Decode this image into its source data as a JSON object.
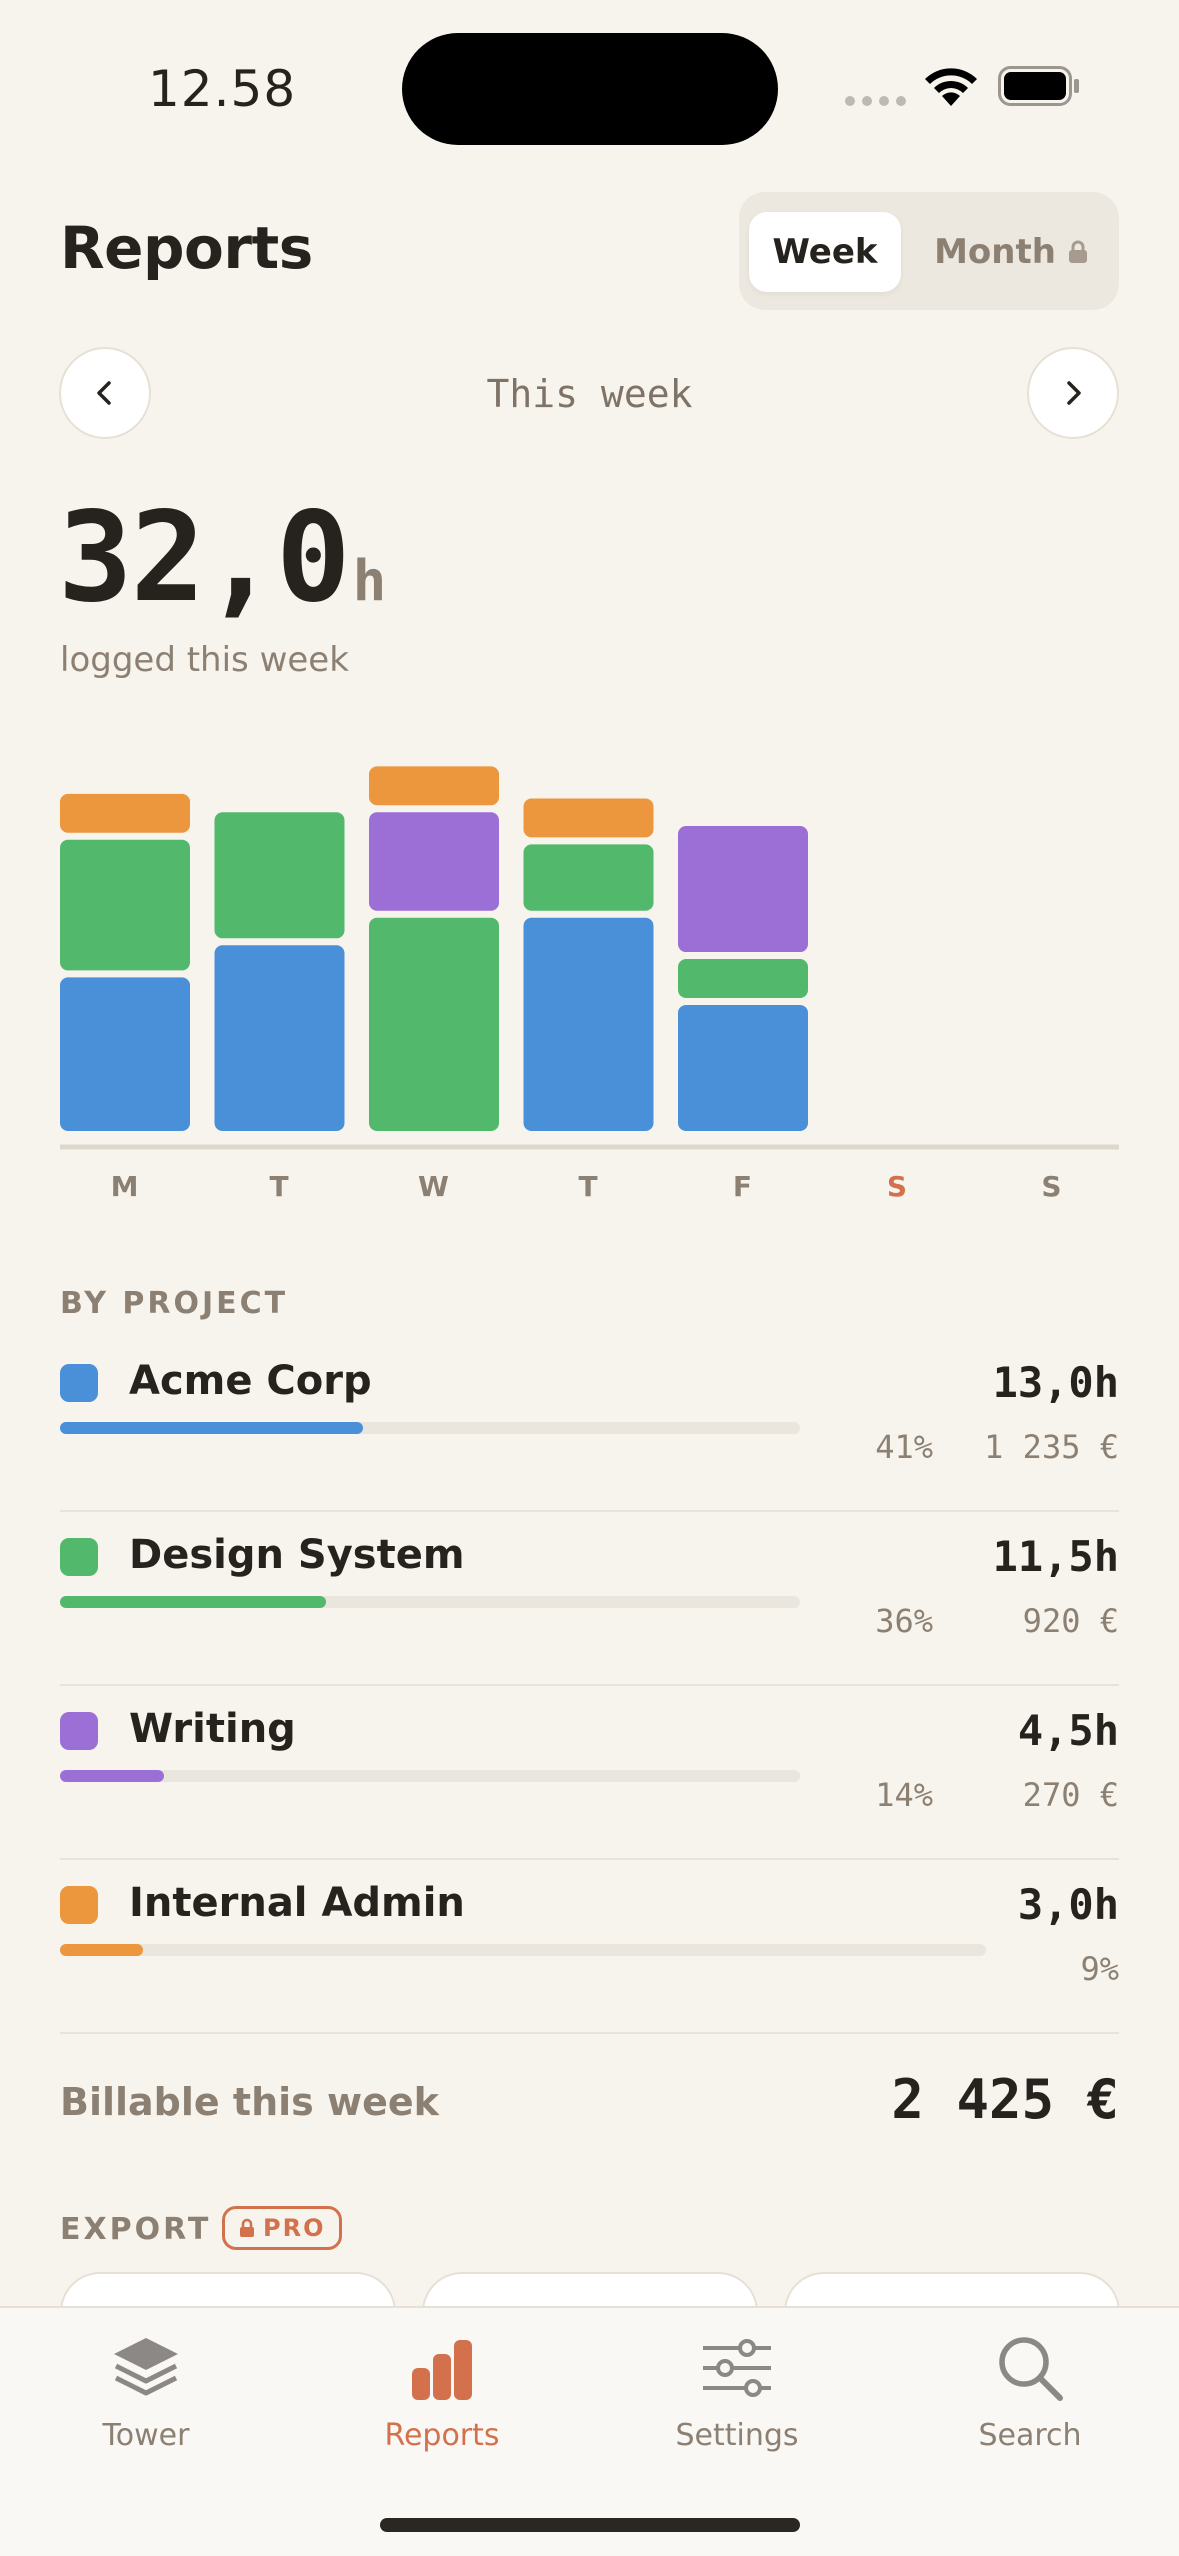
{
  "status": {
    "time": "12.58"
  },
  "header": {
    "title": "Reports",
    "segments": {
      "week": "Week",
      "month": "Month"
    }
  },
  "week_nav": {
    "label": "This week"
  },
  "total": {
    "value": "32,0",
    "unit": "h",
    "caption": "logged this week"
  },
  "colors": {
    "acme": "#4A90D9",
    "design": "#52B96C",
    "writing": "#9B6FD6",
    "admin": "#EC963D",
    "accent": "#D4714D"
  },
  "chart_data": {
    "type": "bar",
    "stacked": true,
    "categories": [
      "M",
      "T",
      "W",
      "T",
      "F",
      "S",
      "S"
    ],
    "weekend_highlight_index": 5,
    "series": [
      {
        "name": "Acme Corp",
        "color": "#4A90D9",
        "values": [
          3.5,
          4.2,
          0,
          4.8,
          2.9,
          0,
          0
        ]
      },
      {
        "name": "Design System",
        "color": "#52B96C",
        "values": [
          3.0,
          2.9,
          4.8,
          1.6,
          1.0,
          0,
          0
        ]
      },
      {
        "name": "Writing",
        "color": "#9B6FD6",
        "values": [
          0,
          0,
          2.3,
          0,
          2.9,
          0,
          0
        ]
      },
      {
        "name": "Internal Admin",
        "color": "#EC963D",
        "values": [
          1.0,
          0,
          1.0,
          1.0,
          0,
          0,
          0
        ]
      }
    ],
    "ylim": [
      0,
      8.5
    ]
  },
  "by_project": {
    "label": "BY PROJECT",
    "items": [
      {
        "name": "Acme Corp",
        "hours": "13,0h",
        "percent": "41%",
        "amount": "1 235 €",
        "share": 0.41,
        "color": "#4A90D9"
      },
      {
        "name": "Design System",
        "hours": "11,5h",
        "percent": "36%",
        "amount": "920 €",
        "share": 0.36,
        "color": "#52B96C"
      },
      {
        "name": "Writing",
        "hours": "4,5h",
        "percent": "14%",
        "amount": "270 €",
        "share": 0.14,
        "color": "#9B6FD6"
      },
      {
        "name": "Internal Admin",
        "hours": "3,0h",
        "percent": "9%",
        "amount": "",
        "share": 0.09,
        "color": "#EC963D"
      }
    ]
  },
  "billable": {
    "label": "Billable this week",
    "value": "2 425 €"
  },
  "export": {
    "label": "EXPORT",
    "badge": "PRO"
  },
  "tabs": [
    {
      "label": "Tower",
      "icon": "layers-icon",
      "active": false
    },
    {
      "label": "Reports",
      "icon": "bar-chart-icon",
      "active": true
    },
    {
      "label": "Settings",
      "icon": "sliders-icon",
      "active": false
    },
    {
      "label": "Search",
      "icon": "search-icon",
      "active": false
    }
  ]
}
